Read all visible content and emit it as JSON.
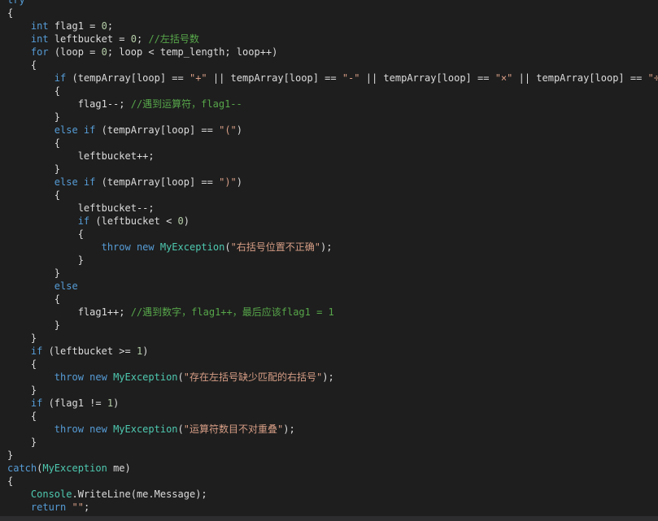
{
  "colors": {
    "background": "#1e1e1e",
    "default": "#dcdcdc",
    "keyword": "#569cd6",
    "string": "#d69d85",
    "comment": "#57a64a",
    "type": "#4ec9b0",
    "number": "#b5cea8"
  },
  "lines": [
    [
      [
        "kw",
        "try"
      ]
    ],
    [
      [
        "p",
        "{"
      ]
    ],
    [
      [
        "p",
        "    "
      ],
      [
        "kw",
        "int"
      ],
      [
        "p",
        " flag1 = "
      ],
      [
        "num",
        "0"
      ],
      [
        "p",
        ";"
      ]
    ],
    [
      [
        "p",
        "    "
      ],
      [
        "kw",
        "int"
      ],
      [
        "p",
        " leftbucket = "
      ],
      [
        "num",
        "0"
      ],
      [
        "p",
        "; "
      ],
      [
        "cm",
        "//左括号数"
      ]
    ],
    [
      [
        "p",
        "    "
      ],
      [
        "kw",
        "for"
      ],
      [
        "p",
        " (loop = "
      ],
      [
        "num",
        "0"
      ],
      [
        "p",
        "; loop < temp_length; loop++)"
      ]
    ],
    [
      [
        "p",
        "    {"
      ]
    ],
    [
      [
        "p",
        "        "
      ],
      [
        "kw",
        "if"
      ],
      [
        "p",
        " (tempArray[loop] == "
      ],
      [
        "str",
        "\"+\""
      ],
      [
        "p",
        " || tempArray[loop] == "
      ],
      [
        "str",
        "\"-\""
      ],
      [
        "p",
        " || tempArray[loop] == "
      ],
      [
        "str",
        "\"×\""
      ],
      [
        "p",
        " || tempArray[loop] == "
      ],
      [
        "str",
        "\"÷\""
      ],
      [
        "p",
        ")"
      ]
    ],
    [
      [
        "p",
        "        {"
      ]
    ],
    [
      [
        "p",
        "            flag1--; "
      ],
      [
        "cm",
        "//遇到运算符，flag1--"
      ]
    ],
    [
      [
        "p",
        "        }"
      ]
    ],
    [
      [
        "p",
        "        "
      ],
      [
        "kw",
        "else if"
      ],
      [
        "p",
        " (tempArray[loop] == "
      ],
      [
        "str",
        "\"(\""
      ],
      [
        "p",
        ")"
      ]
    ],
    [
      [
        "p",
        "        {"
      ]
    ],
    [
      [
        "p",
        "            leftbucket++;"
      ]
    ],
    [
      [
        "p",
        "        }"
      ]
    ],
    [
      [
        "p",
        "        "
      ],
      [
        "kw",
        "else if"
      ],
      [
        "p",
        " (tempArray[loop] == "
      ],
      [
        "str",
        "\")\""
      ],
      [
        "p",
        ")"
      ]
    ],
    [
      [
        "p",
        "        {"
      ]
    ],
    [
      [
        "p",
        "            leftbucket--;"
      ]
    ],
    [
      [
        "p",
        "            "
      ],
      [
        "kw",
        "if"
      ],
      [
        "p",
        " (leftbucket < "
      ],
      [
        "num",
        "0"
      ],
      [
        "p",
        ")"
      ]
    ],
    [
      [
        "p",
        "            {"
      ]
    ],
    [
      [
        "p",
        "                "
      ],
      [
        "kw",
        "throw new"
      ],
      [
        "p",
        " "
      ],
      [
        "ty",
        "MyException"
      ],
      [
        "p",
        "("
      ],
      [
        "str",
        "\"右括号位置不正确\""
      ],
      [
        "p",
        ");"
      ]
    ],
    [
      [
        "p",
        "            }"
      ]
    ],
    [
      [
        "p",
        "        }"
      ]
    ],
    [
      [
        "p",
        "        "
      ],
      [
        "kw",
        "else"
      ]
    ],
    [
      [
        "p",
        "        {"
      ]
    ],
    [
      [
        "p",
        "            flag1++; "
      ],
      [
        "cm",
        "//遇到数字，flag1++，最后应该flag1 = 1"
      ]
    ],
    [
      [
        "p",
        "        }"
      ]
    ],
    [
      [
        "p",
        "    }"
      ]
    ],
    [
      [
        "p",
        "    "
      ],
      [
        "kw",
        "if"
      ],
      [
        "p",
        " (leftbucket >= "
      ],
      [
        "num",
        "1"
      ],
      [
        "p",
        ")"
      ]
    ],
    [
      [
        "p",
        "    {"
      ]
    ],
    [
      [
        "p",
        "        "
      ],
      [
        "kw",
        "throw new"
      ],
      [
        "p",
        " "
      ],
      [
        "ty",
        "MyException"
      ],
      [
        "p",
        "("
      ],
      [
        "str",
        "\"存在左括号缺少匹配的右括号\""
      ],
      [
        "p",
        ");"
      ]
    ],
    [
      [
        "p",
        "    }"
      ]
    ],
    [
      [
        "p",
        "    "
      ],
      [
        "kw",
        "if"
      ],
      [
        "p",
        " (flag1 != "
      ],
      [
        "num",
        "1"
      ],
      [
        "p",
        ")"
      ]
    ],
    [
      [
        "p",
        "    {"
      ]
    ],
    [
      [
        "p",
        "        "
      ],
      [
        "kw",
        "throw new"
      ],
      [
        "p",
        " "
      ],
      [
        "ty",
        "MyException"
      ],
      [
        "p",
        "("
      ],
      [
        "str",
        "\"运算符数目不对重叠\""
      ],
      [
        "p",
        ");"
      ]
    ],
    [
      [
        "p",
        "    }"
      ]
    ],
    [
      [
        "p",
        "}"
      ]
    ],
    [
      [
        "kw",
        "catch"
      ],
      [
        "p",
        "("
      ],
      [
        "ty",
        "MyException"
      ],
      [
        "p",
        " me)"
      ]
    ],
    [
      [
        "p",
        "{"
      ]
    ],
    [
      [
        "p",
        "    "
      ],
      [
        "ty",
        "Console"
      ],
      [
        "p",
        ".WriteLine(me.Message);"
      ]
    ],
    [
      [
        "p",
        "    "
      ],
      [
        "kw",
        "return"
      ],
      [
        "p",
        " "
      ],
      [
        "str",
        "\"\""
      ],
      [
        "p",
        ";"
      ]
    ]
  ]
}
